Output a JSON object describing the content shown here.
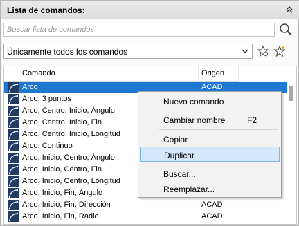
{
  "panel": {
    "title": "Lista de comandos:",
    "collapse_icon": "chevron-double-up-icon"
  },
  "search": {
    "placeholder": "Buscar lista de comandos"
  },
  "filter": {
    "selected": "Únicamente todos los comandos"
  },
  "table": {
    "columns": [
      "Comando",
      "Origen"
    ],
    "rows": [
      {
        "name": "Arco",
        "origin": "ACAD",
        "selected": true
      },
      {
        "name": "Arco, 3 puntos",
        "origin": ""
      },
      {
        "name": "Arco, Centro, Inicio, Ángulo",
        "origin": ""
      },
      {
        "name": "Arco, Centro, Inicio, Fin",
        "origin": ""
      },
      {
        "name": "Arco, Centro, Inicio, Longitud",
        "origin": ""
      },
      {
        "name": "Arco, Continuo",
        "origin": ""
      },
      {
        "name": "Arco, Inicio, Centro, Ángulo",
        "origin": ""
      },
      {
        "name": "Arco, Inicio, Centro, Fin",
        "origin": ""
      },
      {
        "name": "Arco, Inicio, Centro, Longitud",
        "origin": ""
      },
      {
        "name": "Arco, Inicio, Fin, Ángulo",
        "origin": ""
      },
      {
        "name": "Arco, Inicio, Fin, Dirección",
        "origin": "ACAD"
      },
      {
        "name": "Arco, Inicio, Fin, Radio",
        "origin": "ACAD"
      }
    ]
  },
  "context_menu": {
    "items": [
      {
        "label": "Nuevo comando",
        "shortcut": ""
      },
      {
        "label": "Cambiar nombre",
        "shortcut": "F2"
      },
      {
        "label": "Copiar",
        "shortcut": ""
      },
      {
        "label": "Duplicar",
        "shortcut": "",
        "highlighted": true
      },
      {
        "label": "Buscar...",
        "shortcut": ""
      },
      {
        "label": "Reemplazar...",
        "shortcut": ""
      }
    ]
  },
  "colors": {
    "selection": "#1e78d2",
    "menu_highlight": "#d5e8fb",
    "icon_bg": "#243a5e"
  }
}
